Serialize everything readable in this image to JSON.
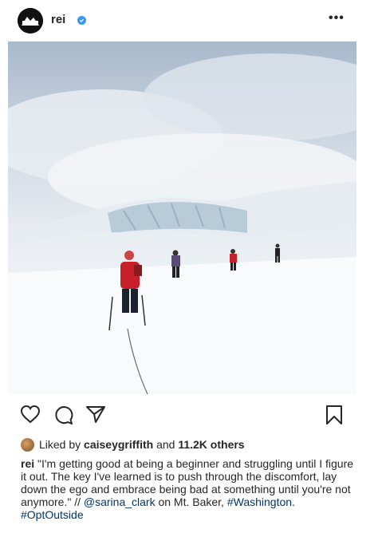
{
  "header": {
    "username": "rei",
    "avatar_text": "REI",
    "more_label": "•••"
  },
  "post": {
    "photo_description_icon": "mountain-photo"
  },
  "actions": {
    "like_icon": "heart-icon",
    "comment_icon": "comment-icon",
    "share_icon": "share-icon",
    "save_icon": "bookmark-icon"
  },
  "likes": {
    "prefix": "Liked by",
    "user": "caiseygriffith",
    "middle": "and",
    "others": "11.2K others"
  },
  "caption": {
    "username": "rei",
    "text": "\"I'm getting good at being a beginner and struggling until I figure it out. The key I've learned is to push through the discomfort, lay down the ego and embrace being bad at something until you're not anymore.\" //",
    "mention": "@sarina_clark",
    "on_text": "on Mt. Baker,",
    "hashtag1": "#Washington",
    "dot": ".",
    "hashtag2": "#OptOutside"
  },
  "colors": {
    "verified": "#3897f0",
    "link": "#003569",
    "text": "#262626"
  }
}
